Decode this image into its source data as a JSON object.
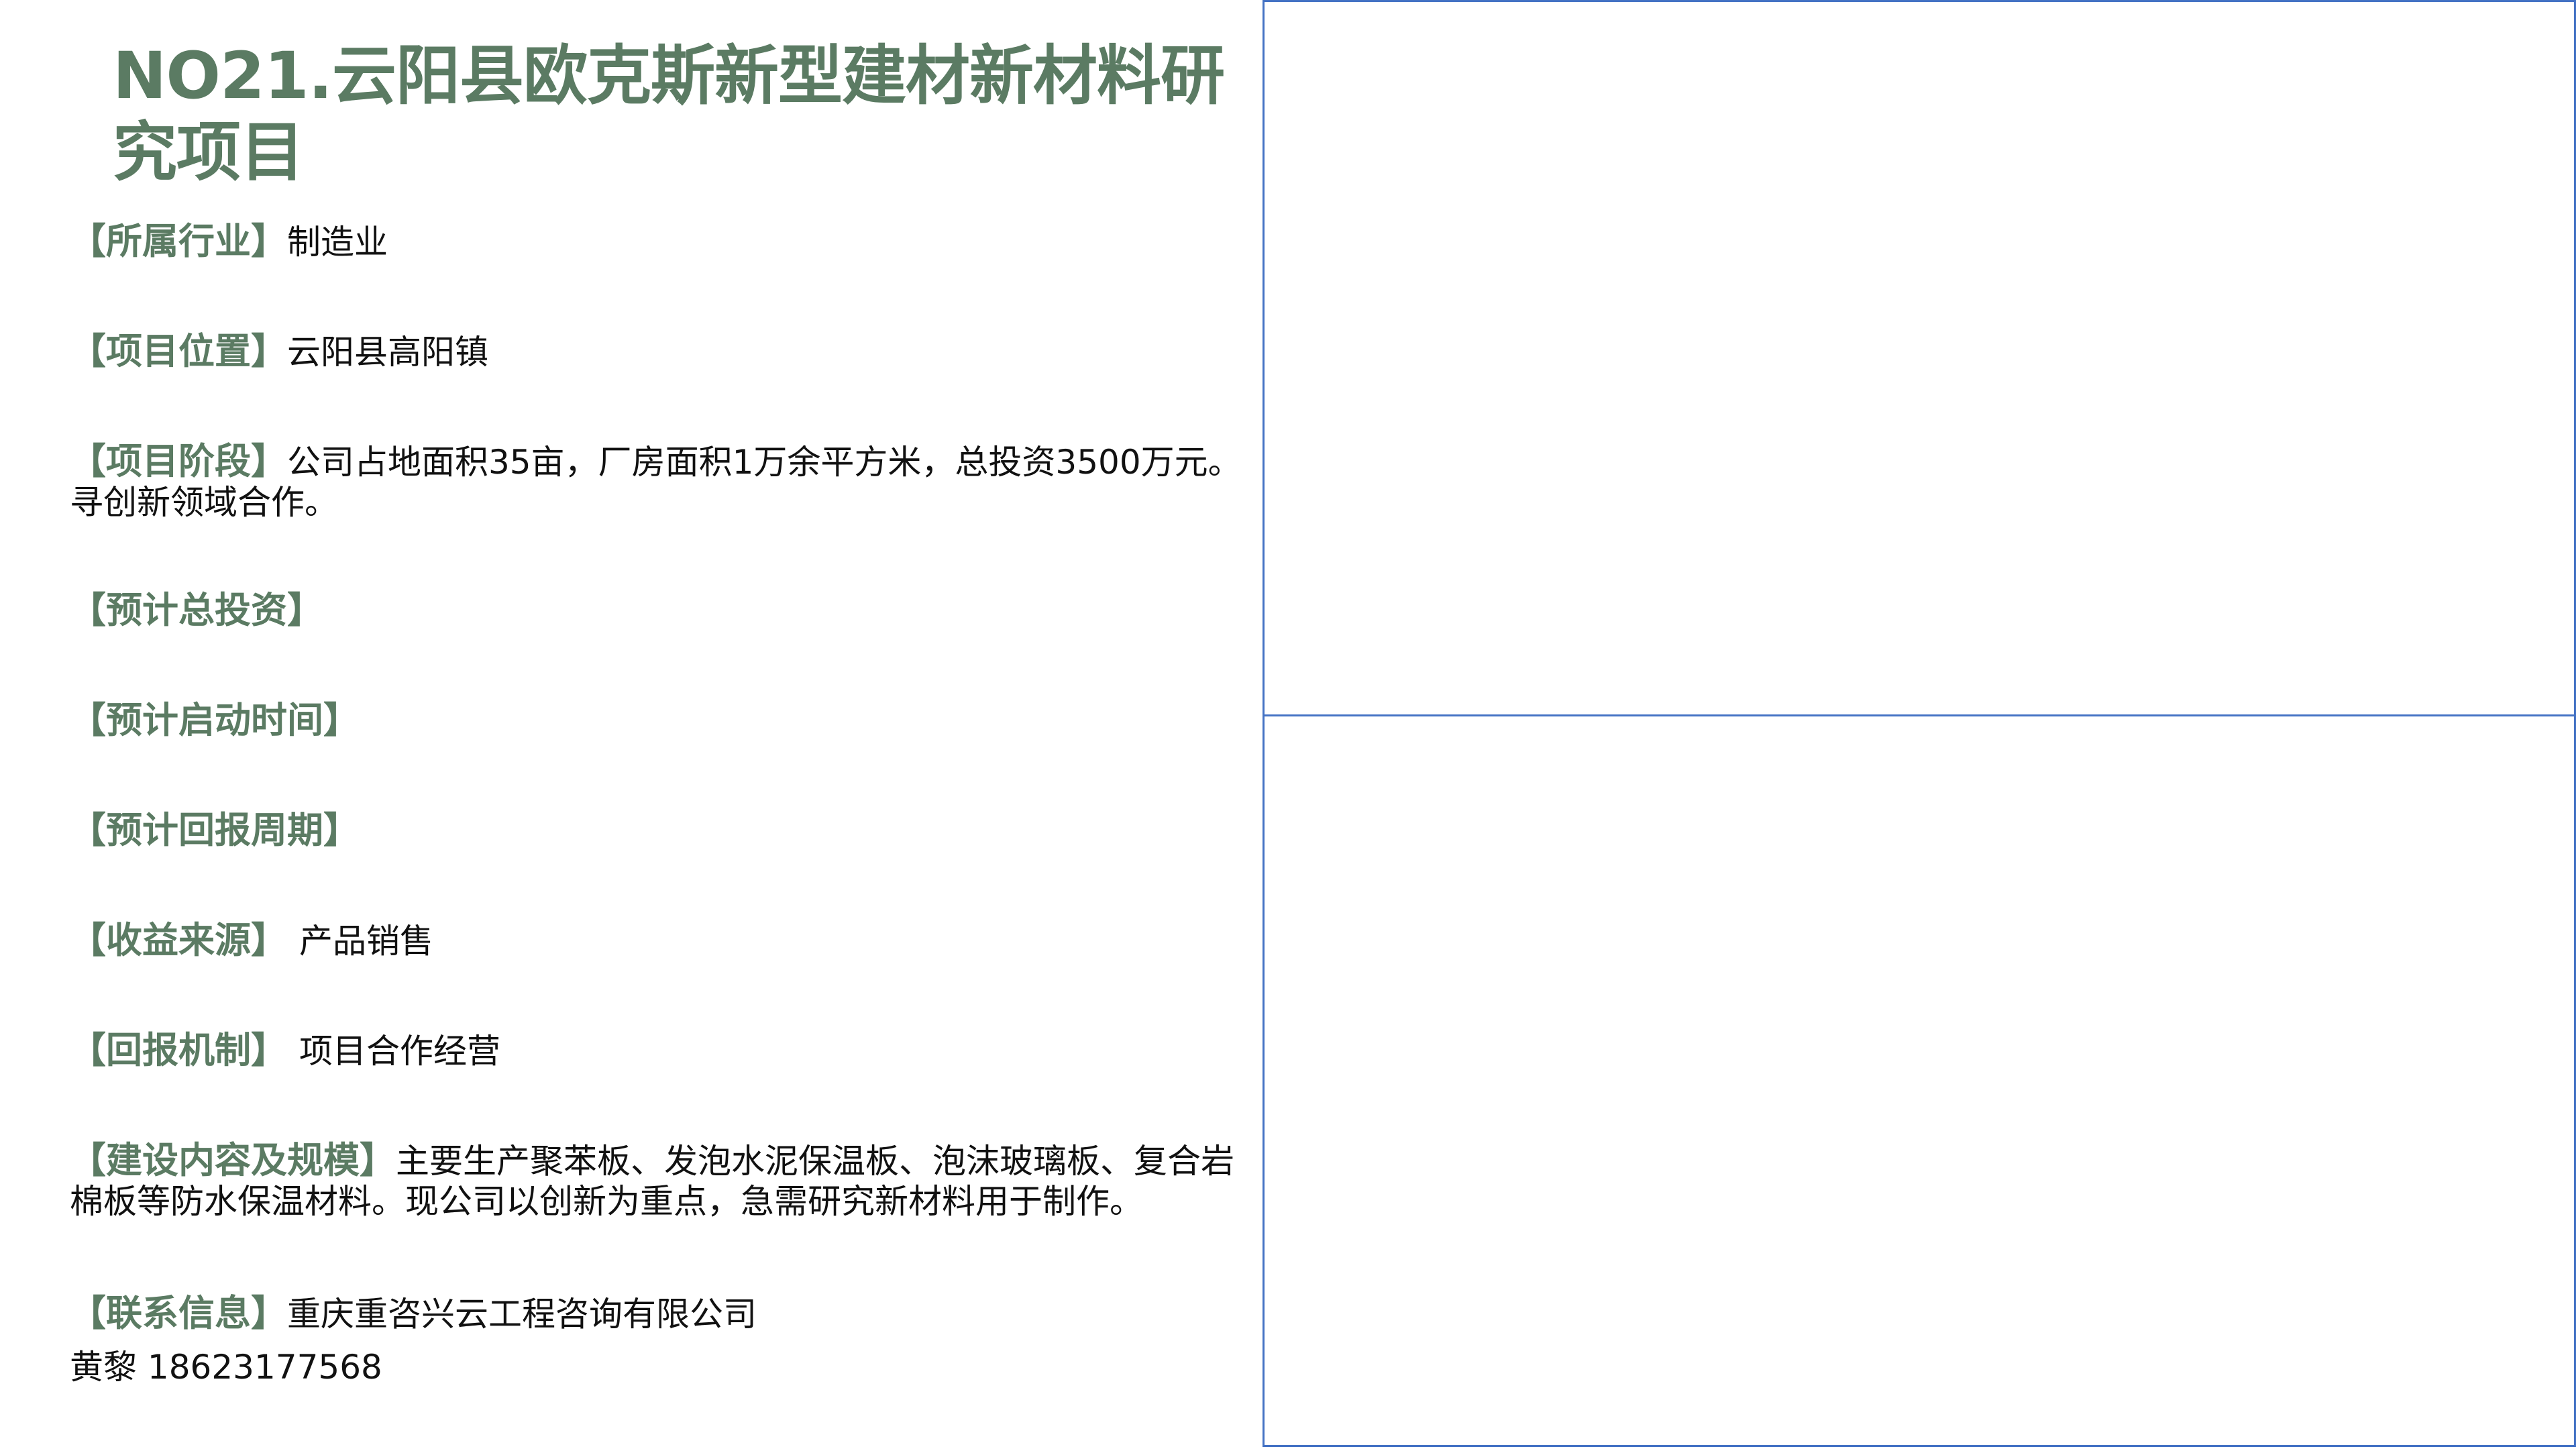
{
  "title": "NO21.云阳县欧克斯新型建材新材料研究项目",
  "fields": [
    {
      "label": "【所属行业】",
      "value": "制造业"
    },
    {
      "label": "【项目位置】",
      "value": "云阳县高阳镇"
    },
    {
      "label": "【项目阶段】",
      "value": "公司占地面积35亩，厂房面积1万余平方米，总投资3500万元。寻创新领域合作。"
    },
    {
      "label": "【预计总投资】",
      "value": ""
    },
    {
      "label": "【预计启动时间】",
      "value": ""
    },
    {
      "label": "【预计回报周期】",
      "value": ""
    },
    {
      "label": "【收益来源】",
      "value": "产品销售"
    },
    {
      "label": "【回报机制】",
      "value": "项目合作经营"
    },
    {
      "label": "【建设内容及规模】",
      "value": "主要生产聚苯板、发泡水泥保温板、泡沫玻璃板、复合岩棉板等防水保温材料。现公司以创新为重点，急需研究新材料用于制作。"
    },
    {
      "label": "【联系信息】",
      "value": "重庆重咨兴云工程咨询有限公司"
    }
  ],
  "contact_person": "黄黎 18623177568",
  "colors": {
    "accent_green": "#5b7b63",
    "frame_blue": "#4472c4"
  }
}
